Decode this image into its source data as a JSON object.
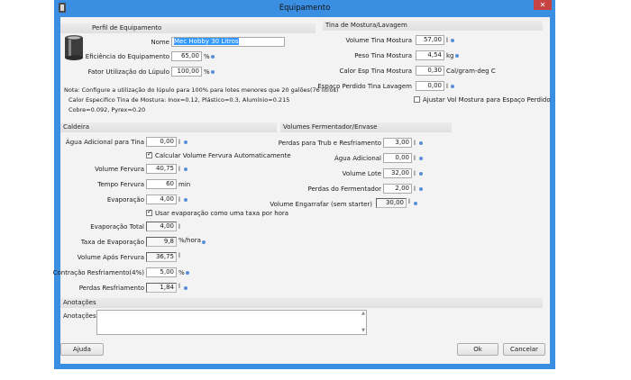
{
  "window": {
    "title": "Equipamento",
    "close_glyph": "✕"
  },
  "perfil": {
    "section_title": "Perfil de Equipamento",
    "nome_label": "Nome",
    "nome_value": "Mec Hobby 30 Litros",
    "eficiencia_label": "Eficiência do Equipamento",
    "eficiencia_value": "65,00",
    "eficiencia_unit": "%",
    "lupulo_label": "Fator Utilização do Lúpulo",
    "lupulo_value": "100,00",
    "lupulo_unit": "%",
    "note_line1": "Nota: Configure a utilização do lúpulo para 100% para lotes menores que 20 galões(76 litros)",
    "note_line2": "Calor Especifico Tina de Mostura: Inox=0.12, Plástico=0.3, Alumínio=0.215",
    "note_line3": "Cobre=0.092, Pyrex=0.20"
  },
  "tina": {
    "section_title": "Tina de Mostura/Lavagem",
    "volume_label": "Volume Tina Mostura",
    "volume_value": "57,00",
    "volume_unit": "l",
    "peso_label": "Peso Tina Mostura",
    "peso_value": "4,54",
    "peso_unit": "kg",
    "calor_label": "Calor Esp Tina Mostura",
    "calor_value": "0,30",
    "calor_unit": "Cal/gram-deg C",
    "perdido_label": "Espaço Perdido Tina Lavagem",
    "perdido_value": "0,00",
    "perdido_unit": "l",
    "ajustar_label": "Ajustar Vol Mostura para Espaço Perdido"
  },
  "caldeira": {
    "section_title": "Caldeira",
    "agua_label": "Água Adicional para Tina",
    "agua_value": "0,00",
    "agua_unit": "l",
    "calc_label": "Calcular Volume Fervura Automaticamente",
    "volfervura_label": "Volume Fervura",
    "volfervura_value": "40,75",
    "volfervura_unit": "l",
    "tempo_label": "Tempo Fervura",
    "tempo_value": "60",
    "tempo_unit": "min",
    "evap_label": "Evaporação",
    "evap_value": "4,00",
    "evap_unit": "l",
    "usar_label": "Usar evaporação como uma taxa por hora",
    "evaptotal_label": "Evaporação Total",
    "evaptotal_value": "4,00",
    "evaptotal_unit": "l",
    "taxa_label": "Taxa de Evaporação",
    "taxa_value": "9,8",
    "taxa_unit": "%/hora",
    "apos_label": "Volume Após Fervura",
    "apos_value": "36,75",
    "apos_unit": "l",
    "contr_label": "Contração Resfriamento(4%)",
    "contr_value": "5,00",
    "contr_unit": "%",
    "perdas_label": "Perdas Resfriamento",
    "perdas_value": "1,84",
    "perdas_unit": "l"
  },
  "volumes": {
    "section_title": "Volumes Fermentador/Envase",
    "trub_label": "Perdas para Trub e Resfriamento",
    "trub_value": "3,00",
    "trub_unit": "l",
    "agua_label": "Água Adicional",
    "agua_value": "0,00",
    "agua_unit": "l",
    "lote_label": "Volume Lote",
    "lote_value": "32,00",
    "lote_unit": "l",
    "ferm_label": "Perdas do Fermentador",
    "ferm_value": "2,00",
    "ferm_unit": "l",
    "engarrafar_label": "Volume Engarrafar (sem starter)",
    "engarrafar_value": "30,00",
    "engarrafar_unit": "l"
  },
  "anotacoes": {
    "section_title": "Anotações",
    "label": "Anotações",
    "value": ""
  },
  "buttons": {
    "ajuda": "Ajuda",
    "ok": "Ok",
    "cancelar": "Cancelar"
  },
  "colors": {
    "titlebar": "#3a8fe3",
    "close": "#c74343",
    "info_dot": "#5a8fd6",
    "selection": "#3399ff"
  }
}
